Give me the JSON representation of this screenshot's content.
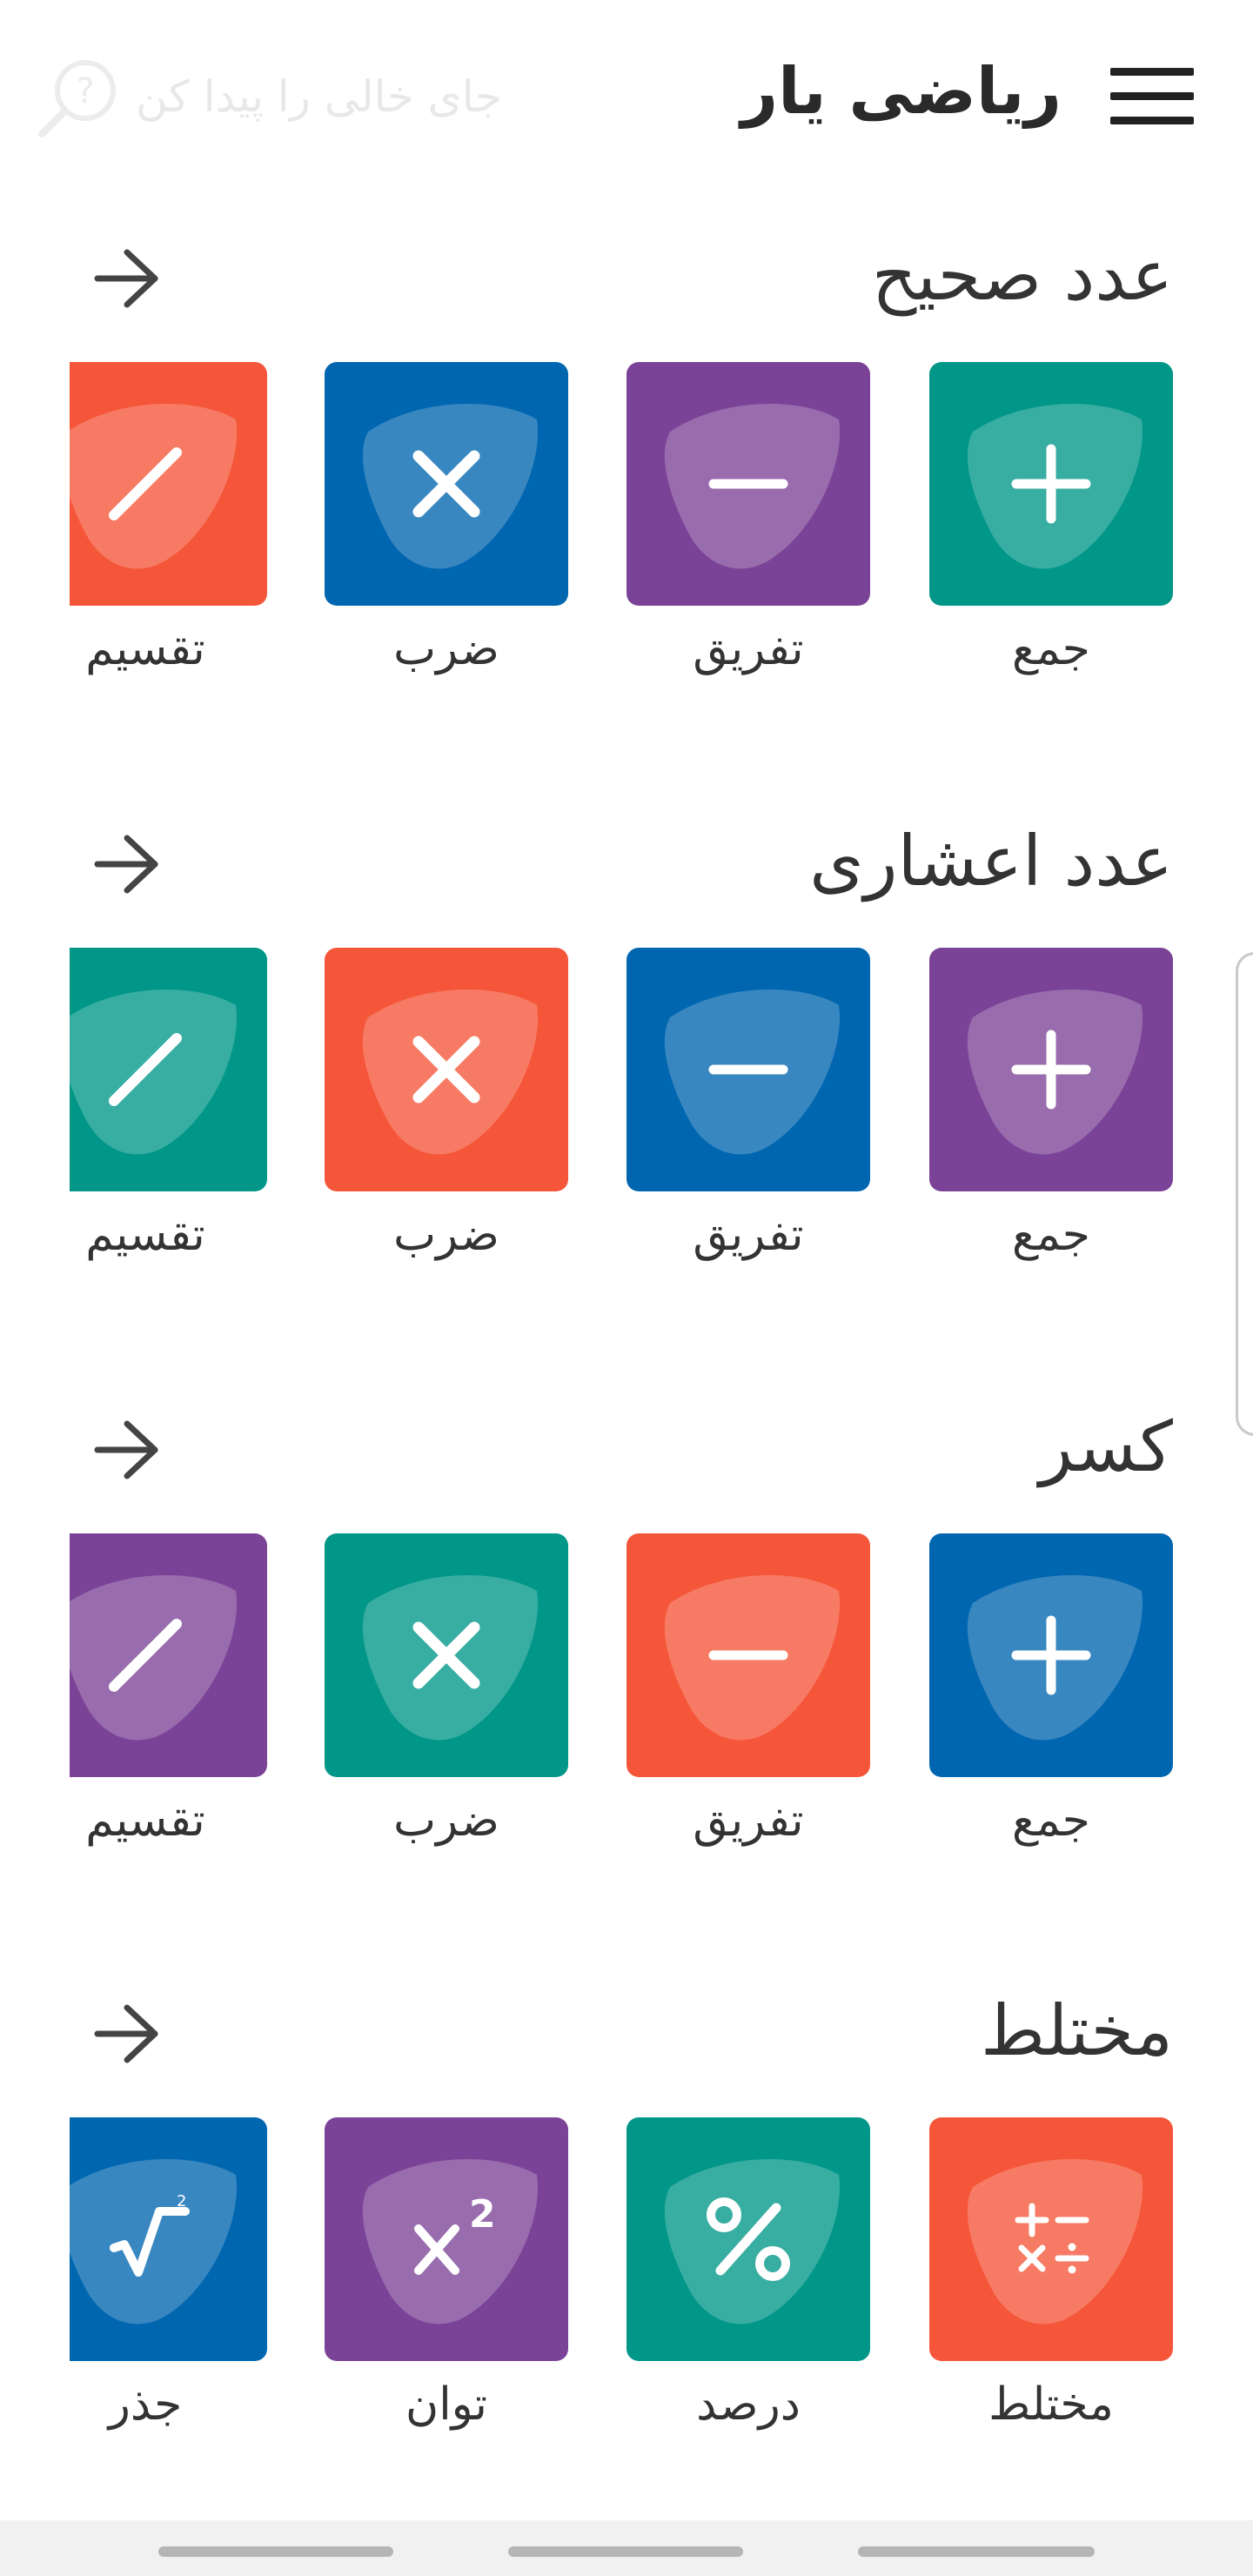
{
  "header": {
    "title": "ریاضی یار",
    "search_placeholder": "جای خالی را پیدا کن"
  },
  "colors": {
    "green": "#009688",
    "purple": "#7b4397",
    "blue": "#0066b0",
    "orange": "#f55639"
  },
  "sections": [
    {
      "title": "عدد صحیح",
      "tiles": [
        {
          "label": "جمع",
          "color": "#009688",
          "icon": "plus-icon"
        },
        {
          "label": "تفریق",
          "color": "#7b4397",
          "icon": "minus-icon"
        },
        {
          "label": "ضرب",
          "color": "#0066b0",
          "icon": "times-icon"
        },
        {
          "label": "تقسیم",
          "color": "#f55639",
          "icon": "divide-slash-icon"
        }
      ]
    },
    {
      "title": "عدد اعشاری",
      "tiles": [
        {
          "label": "جمع",
          "color": "#7b4397",
          "icon": "plus-icon"
        },
        {
          "label": "تفریق",
          "color": "#0066b0",
          "icon": "minus-icon"
        },
        {
          "label": "ضرب",
          "color": "#f55639",
          "icon": "times-icon"
        },
        {
          "label": "تقسیم",
          "color": "#009688",
          "icon": "divide-slash-icon"
        }
      ]
    },
    {
      "title": "کسر",
      "tiles": [
        {
          "label": "جمع",
          "color": "#0066b0",
          "icon": "plus-icon"
        },
        {
          "label": "تفریق",
          "color": "#f55639",
          "icon": "minus-icon"
        },
        {
          "label": "ضرب",
          "color": "#009688",
          "icon": "times-icon"
        },
        {
          "label": "تقسیم",
          "color": "#7b4397",
          "icon": "divide-slash-icon"
        }
      ]
    },
    {
      "title": "مختلط",
      "tiles": [
        {
          "label": "مختلط",
          "color": "#f55639",
          "icon": "mixed-operations-icon"
        },
        {
          "label": "درصد",
          "color": "#009688",
          "icon": "percent-icon"
        },
        {
          "label": "توان",
          "color": "#7b4397",
          "icon": "power-icon"
        },
        {
          "label": "جذر",
          "color": "#0066b0",
          "icon": "square-root-icon"
        }
      ]
    }
  ]
}
